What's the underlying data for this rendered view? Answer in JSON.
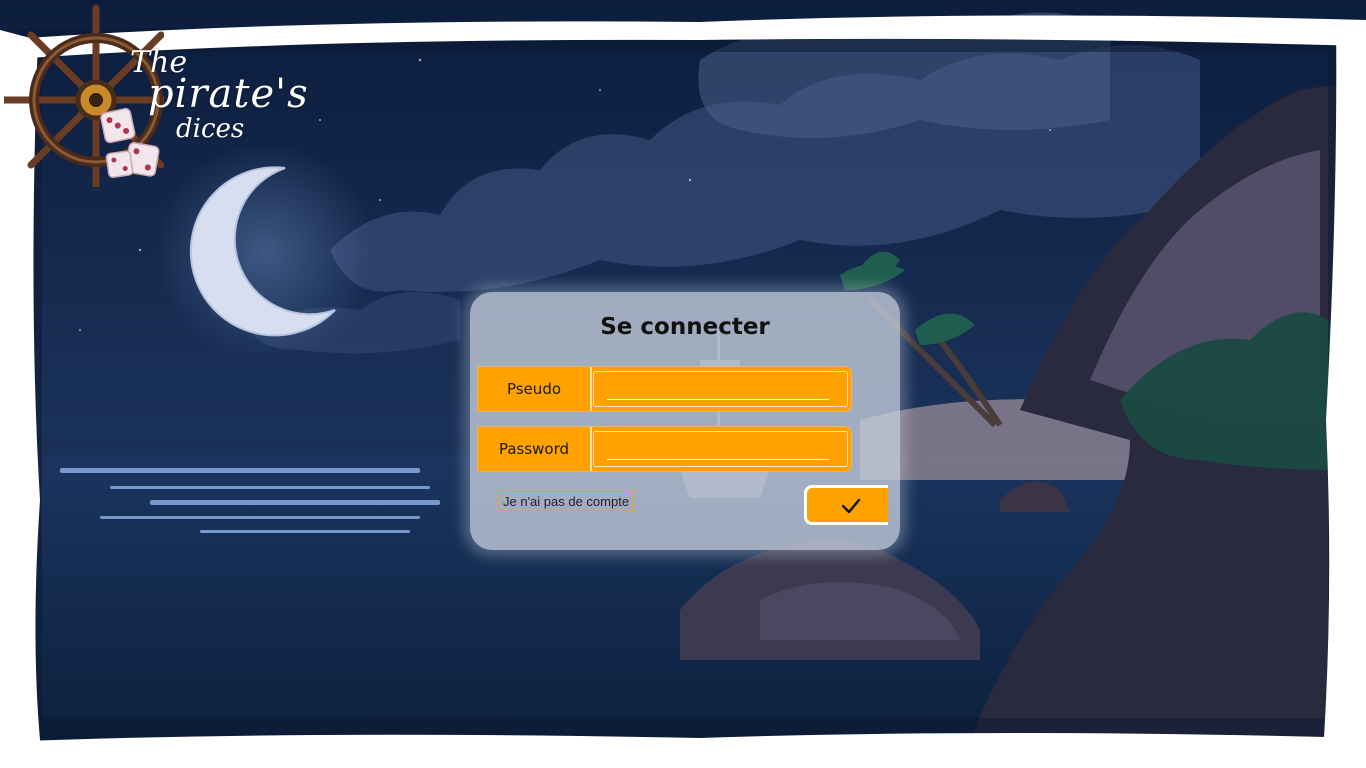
{
  "logo": {
    "line1": "The",
    "line2": "pirate's",
    "line3": "dices"
  },
  "login": {
    "title": "Se connecter",
    "pseudo_label": "Pseudo",
    "pseudo_value": "",
    "password_label": "Password",
    "password_value": "",
    "no_account_label": "Je n'ai pas de compte",
    "submit_icon": "checkmark-icon"
  },
  "colors": {
    "accent": "#ffa200",
    "panel": "#c8d0de",
    "frame": "#ffffff",
    "night_sky": "#14284a"
  }
}
